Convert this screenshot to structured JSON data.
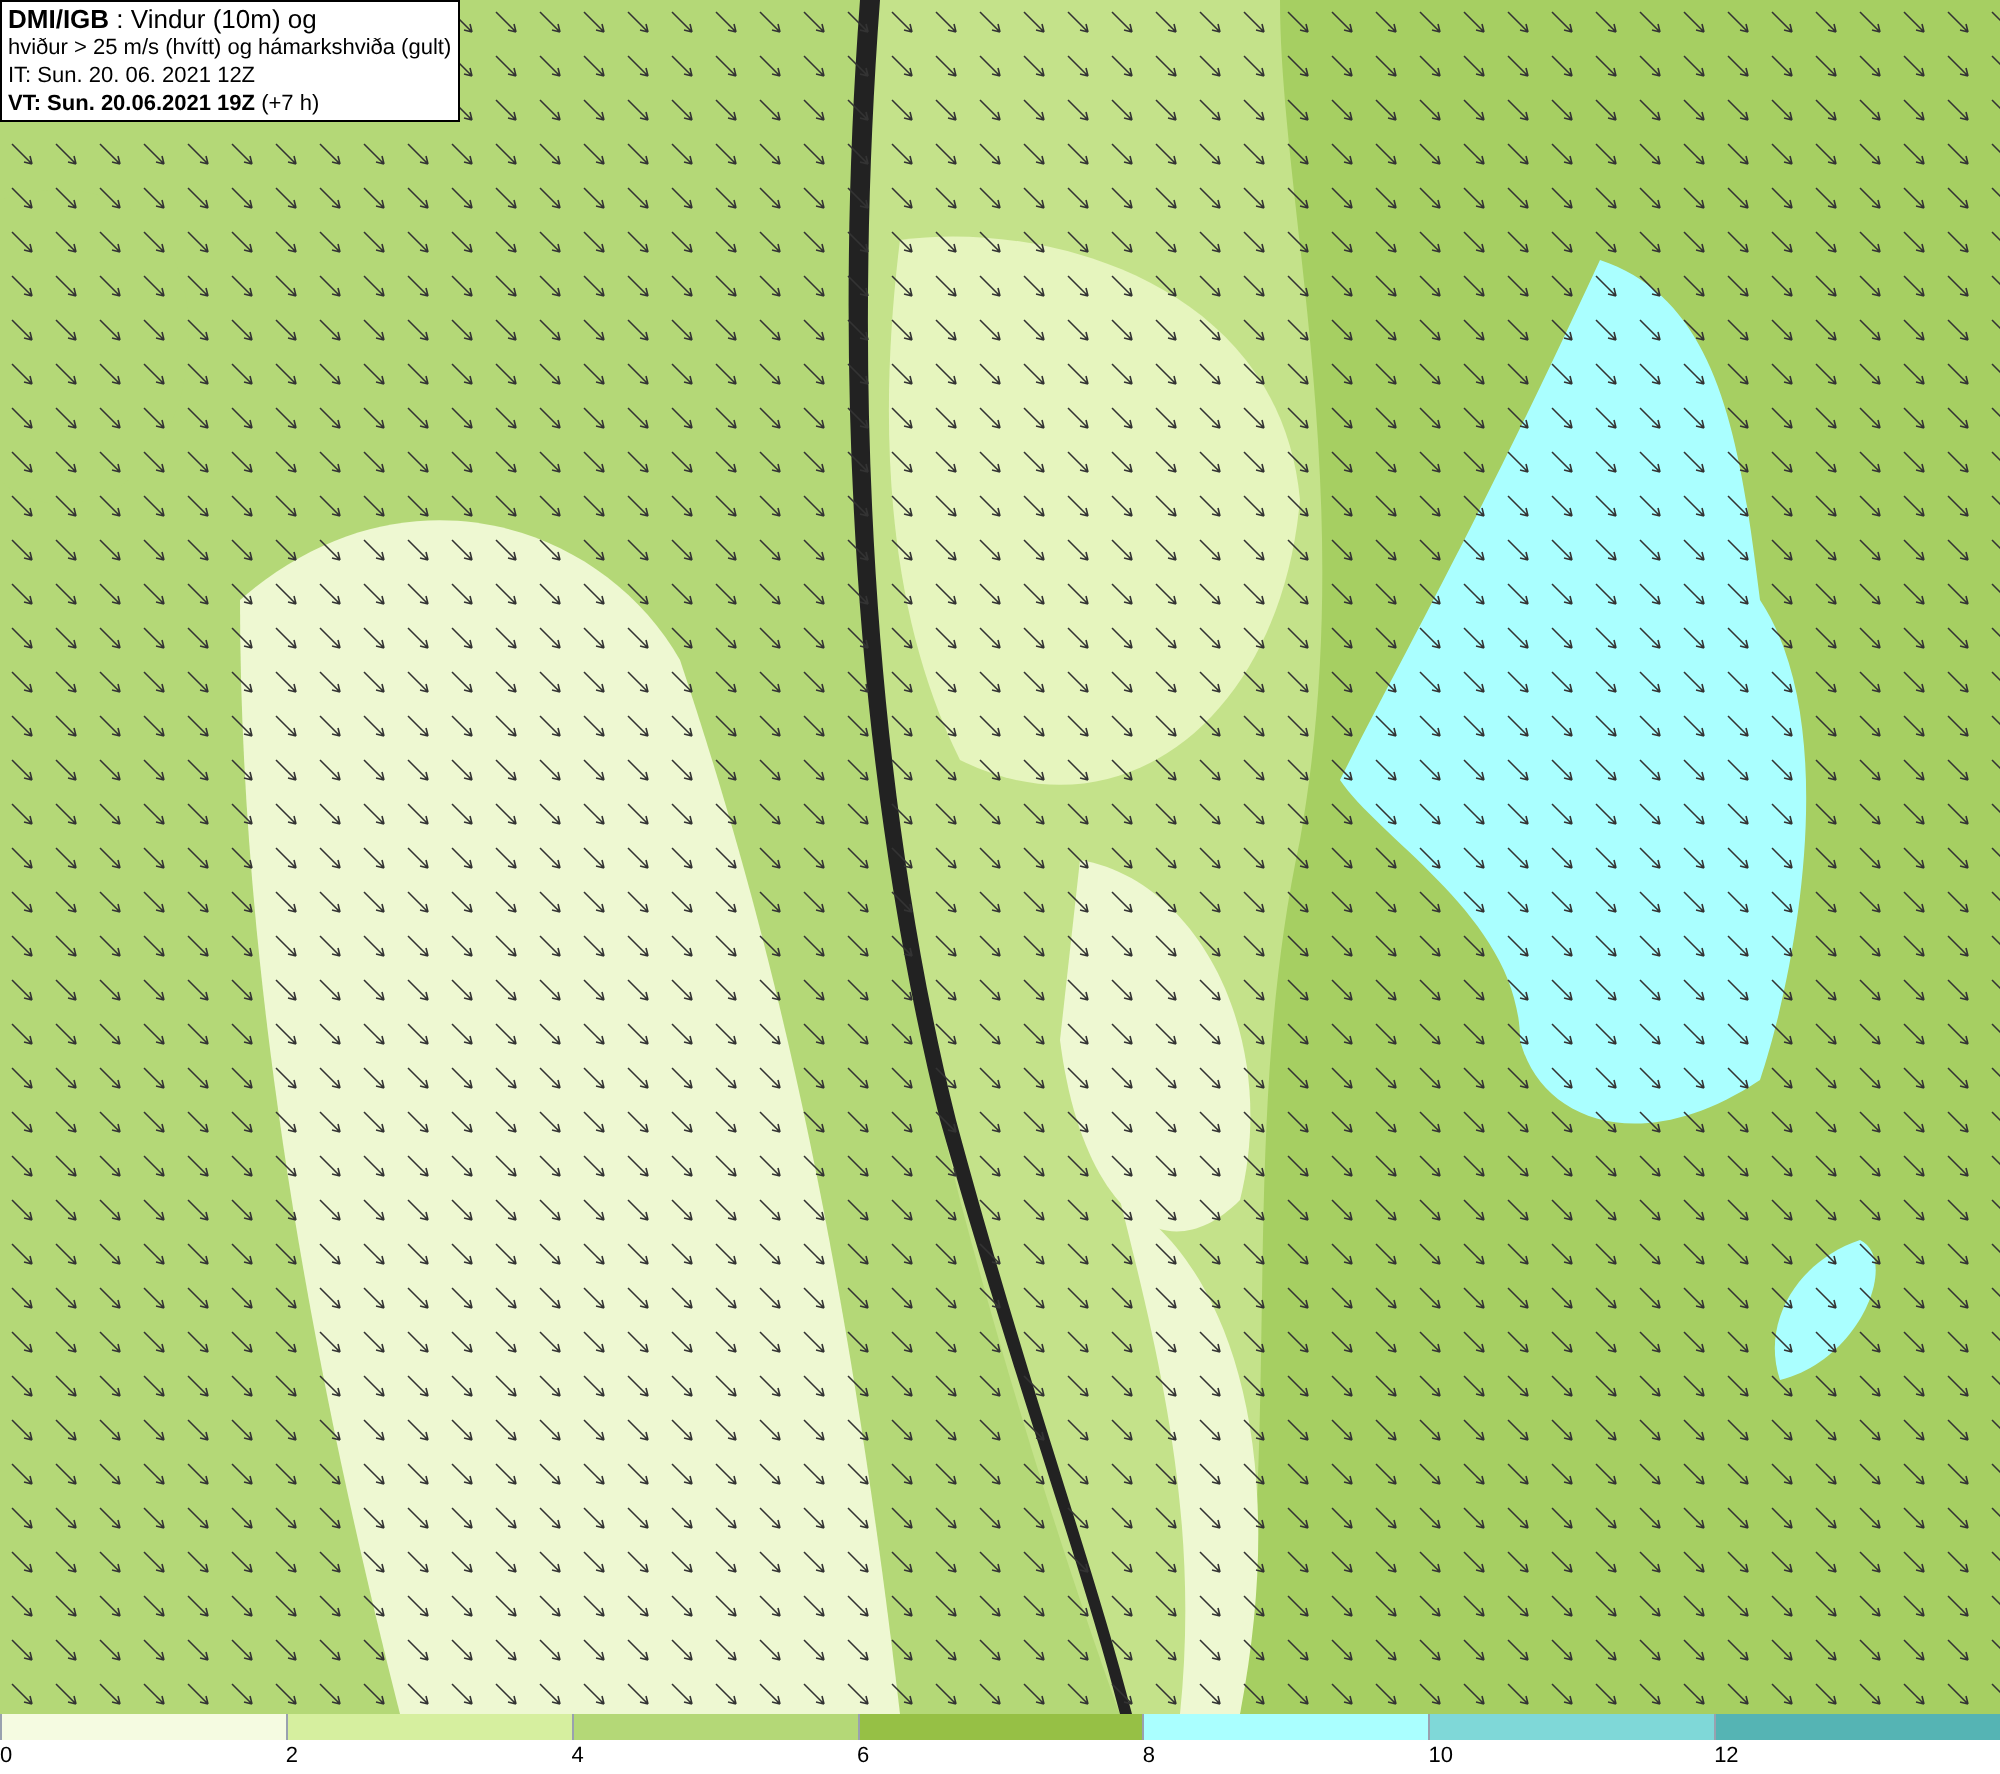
{
  "header": {
    "lines": [
      "**DMI/IGB** : Vindur (10m) og",
      "hviður > 25 m/s (hvítt) og hámarkshviða (gult)",
      "IT: Sun. 20. 06. 2021 12Z",
      "**VT: Sun. 20.06.2021 19Z** (+7 h)"
    ]
  },
  "legend": {
    "bins": [
      {
        "label": "0",
        "color": "#f5fbe1"
      },
      {
        "label": "2",
        "color": "#d6ef9f"
      },
      {
        "label": "4",
        "color": "#b4d877"
      },
      {
        "label": "6",
        "color": "#96c045"
      },
      {
        "label": "8",
        "color": "#aaffff"
      },
      {
        "label": "10",
        "color": "#7fd8d8"
      },
      {
        "label": "12",
        "color": "#55b4b4"
      }
    ]
  }
}
